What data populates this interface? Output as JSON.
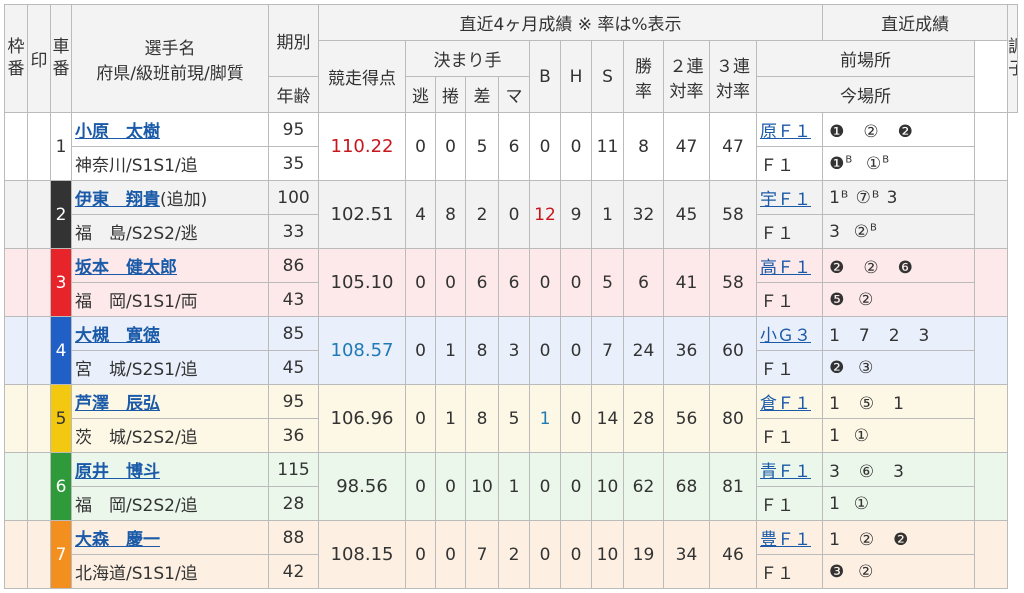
{
  "header": {
    "waku": "枠番",
    "shirushi": "印",
    "shaban": "車番",
    "name_top": "選手名",
    "name_bottom": "府県/級班前現/脚質",
    "period": "期別",
    "age": "年齢",
    "recent4": "直近4ヶ月成績 ※ 率は%表示",
    "score": "競走得点",
    "kimarite": "決まり手",
    "nige": "逃",
    "makuri": "捲",
    "sashi": "差",
    "mark": "マ",
    "b": "B",
    "h": "H",
    "s": "S",
    "win_a": "勝",
    "win_b": "率",
    "ren2_a": "２連",
    "ren2_b": "対率",
    "ren3_a": "３連",
    "ren3_b": "対率",
    "recent": "直近成績",
    "prev_venue": "前場所",
    "cur_venue": "今場所",
    "condition": "調子"
  },
  "colors": {
    "frame": [
      "#ffffff",
      "#333333",
      "#e8242b",
      "#1f5fc6",
      "#f2c811",
      "#2e9a3a",
      "#f28f1f"
    ],
    "row_bg": [
      "#ffffff",
      "#f2f2f2",
      "#fde9e9",
      "#e9effb",
      "#fdf8e6",
      "#eaf7ea",
      "#fdf0e3"
    ]
  },
  "riders": [
    {
      "car": "1",
      "name": "小原　太樹",
      "extra": "",
      "pref": "神奈川/S1S1/追",
      "period": "95",
      "age": "35",
      "score": "110.22",
      "score_color": "red",
      "nige": "0",
      "makuri": "0",
      "sashi": "5",
      "mark": "6",
      "b": "0",
      "b_color": "",
      "h": "0",
      "s": "11",
      "win": "8",
      "ren2": "47",
      "ren3": "47",
      "prev_venue": "原Ｆ１",
      "prev_res": "❶　②　❷",
      "cur_venue": "Ｆ１",
      "cur_res_a": "❶",
      "cur_sup_a": "B",
      "cur_res_b": "①",
      "cur_sup_b": "B",
      "cur_res_c": ""
    },
    {
      "car": "2",
      "name": "伊東　翔貴",
      "extra": "(追加)",
      "pref": "福　島/S2S2/逃",
      "period": "100",
      "age": "33",
      "score": "102.51",
      "score_color": "",
      "nige": "4",
      "makuri": "8",
      "sashi": "2",
      "mark": "0",
      "b": "12",
      "b_color": "red",
      "h": "9",
      "s": "1",
      "win": "32",
      "ren2": "45",
      "ren3": "58",
      "prev_venue": "宇Ｆ１",
      "prev_res": "1ᴮ ⑦ᴮ 3",
      "cur_venue": "Ｆ１",
      "cur_res_a": "3",
      "cur_sup_a": "",
      "cur_res_b": "②",
      "cur_sup_b": "B",
      "cur_res_c": ""
    },
    {
      "car": "3",
      "name": "坂本　健太郎",
      "extra": "",
      "pref": "福　岡/S1S1/両",
      "period": "86",
      "age": "43",
      "score": "105.10",
      "score_color": "",
      "nige": "0",
      "makuri": "0",
      "sashi": "6",
      "mark": "6",
      "b": "0",
      "b_color": "",
      "h": "0",
      "s": "5",
      "win": "6",
      "ren2": "41",
      "ren3": "58",
      "prev_venue": "高Ｆ１",
      "prev_res": "❷　②　❻",
      "cur_venue": "Ｆ１",
      "cur_res_a": "❺",
      "cur_sup_a": "",
      "cur_res_b": "②",
      "cur_sup_b": "",
      "cur_res_c": ""
    },
    {
      "car": "4",
      "name": "大槻　寛徳",
      "extra": "",
      "pref": "宮　城/S2S1/追",
      "period": "85",
      "age": "45",
      "score": "108.57",
      "score_color": "blue",
      "nige": "0",
      "makuri": "1",
      "sashi": "8",
      "mark": "3",
      "b": "0",
      "b_color": "",
      "h": "0",
      "s": "7",
      "win": "24",
      "ren2": "36",
      "ren3": "60",
      "prev_venue": "小Ｇ３",
      "prev_res": "1　7　2　3",
      "cur_venue": "Ｆ１",
      "cur_res_a": "❷",
      "cur_sup_a": "",
      "cur_res_b": "③",
      "cur_sup_b": "",
      "cur_res_c": ""
    },
    {
      "car": "5",
      "name": "芦澤　辰弘",
      "extra": "",
      "pref": "茨　城/S2S2/追",
      "period": "95",
      "age": "36",
      "score": "106.96",
      "score_color": "",
      "nige": "0",
      "makuri": "1",
      "sashi": "8",
      "mark": "5",
      "b": "1",
      "b_color": "blue",
      "h": "0",
      "s": "14",
      "win": "28",
      "ren2": "56",
      "ren3": "80",
      "prev_venue": "倉Ｆ１",
      "prev_res": "1　⑤　1",
      "cur_venue": "Ｆ１",
      "cur_res_a": "1",
      "cur_sup_a": "",
      "cur_res_b": "①",
      "cur_sup_b": "",
      "cur_res_c": ""
    },
    {
      "car": "6",
      "name": "原井　博斗",
      "extra": "",
      "pref": "福　岡/S2S2/追",
      "period": "115",
      "age": "28",
      "score": "98.56",
      "score_color": "",
      "nige": "0",
      "makuri": "0",
      "sashi": "10",
      "mark": "1",
      "b": "0",
      "b_color": "",
      "h": "0",
      "s": "10",
      "win": "62",
      "ren2": "68",
      "ren3": "81",
      "prev_venue": "青Ｆ１",
      "prev_res": "3　⑥　3",
      "cur_venue": "Ｆ１",
      "cur_res_a": "1",
      "cur_sup_a": "",
      "cur_res_b": "①",
      "cur_sup_b": "",
      "cur_res_c": ""
    },
    {
      "car": "7",
      "name": "大森　慶一",
      "extra": "",
      "pref": "北海道/S1S1/追",
      "period": "88",
      "age": "42",
      "score": "108.15",
      "score_color": "",
      "nige": "0",
      "makuri": "0",
      "sashi": "7",
      "mark": "2",
      "b": "0",
      "b_color": "",
      "h": "0",
      "s": "10",
      "win": "19",
      "ren2": "34",
      "ren3": "46",
      "prev_venue": "豊Ｆ１",
      "prev_res": "1　②　❷",
      "cur_venue": "Ｆ１",
      "cur_res_a": "❸",
      "cur_sup_a": "",
      "cur_res_b": "②",
      "cur_sup_b": "",
      "cur_res_c": ""
    }
  ]
}
